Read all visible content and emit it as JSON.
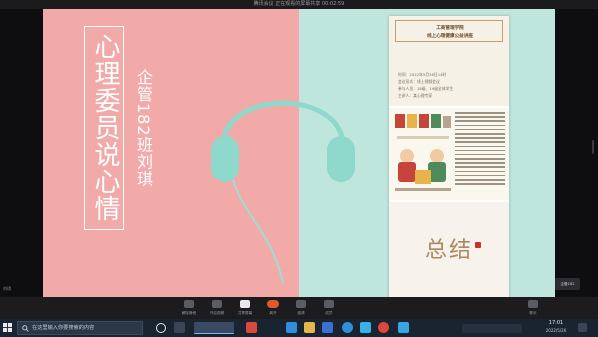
{
  "window": {
    "title": "腾讯会议 正在观看的屏幕共享 00:02:59"
  },
  "slide": {
    "main_title": "心理委员说心情",
    "subtitle": "企管182班刘琪",
    "colors": {
      "pink": "#f1aaa8",
      "teal": "#bfe6dd",
      "headphone": "#8fd8cc"
    }
  },
  "phone": {
    "header_line1": "工商管理学院",
    "header_line2": "线上心理健康公益讲座",
    "info": [
      "时间：2022年5月26日14时",
      "会议形式：线上视频会议",
      "参与人员：18级、19级全体学生",
      "主讲人：某心理专家"
    ],
    "summary_title": "总结"
  },
  "participant": {
    "name": "企管182"
  },
  "left_label": "刘琪",
  "toolbar": [
    {
      "name": "mute",
      "label": "解除静音"
    },
    {
      "name": "video",
      "label": "开启视频"
    },
    {
      "name": "share",
      "label": "共享屏幕"
    },
    {
      "name": "leave",
      "label": "离开"
    },
    {
      "name": "invite",
      "label": "邀请"
    },
    {
      "name": "members",
      "label": "成员"
    },
    {
      "name": "chat",
      "label": "聊天"
    }
  ],
  "taskbar": {
    "search_placeholder": "在这里输入你要搜索的内容",
    "time": "17:01",
    "date": "2022/5/26"
  }
}
